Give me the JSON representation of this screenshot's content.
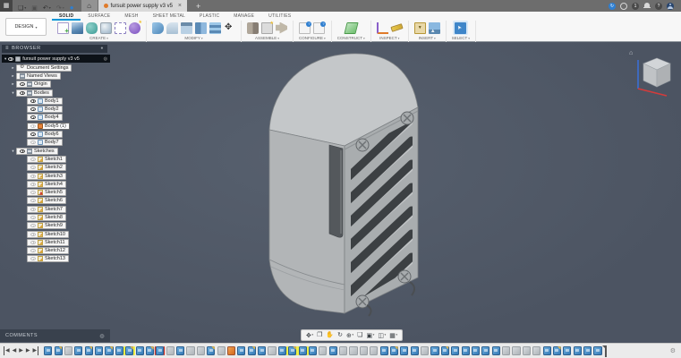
{
  "colors": {
    "accent_blue": "#0696d7",
    "viewport_bg": "#515a66",
    "model_gray": "#b3b6b8",
    "timeline_blue": "#3f8ac9",
    "highlight_yellow": "#eff046",
    "error_red": "#cf3b2f",
    "active_orange": "#e8833a"
  },
  "topbar": {
    "app_grid_glyph": "▦",
    "left_icons": [
      {
        "glyph": "❏",
        "cls": "caret",
        "name": "file-menu-icon"
      },
      {
        "glyph": "▣",
        "cls": "dim",
        "name": "save-icon"
      },
      {
        "glyph": "↶",
        "cls": "caret",
        "name": "undo-icon"
      },
      {
        "glyph": "↷",
        "cls": "dim caret",
        "name": "redo-icon"
      },
      {
        "glyph": "●",
        "cls": "blue",
        "name": "extension-icon"
      }
    ],
    "home_glyph": "⌂",
    "doc_tab": {
      "title": "fursuit power supply v3 v5",
      "close": "×"
    },
    "new_tab": "+",
    "right_icons": [
      {
        "glyph": "↻",
        "cls": "c-blue",
        "name": "job-status-icon"
      },
      {
        "glyph": "",
        "cls": "c-ring",
        "name": "status-ring-icon"
      },
      {
        "glyph": "1",
        "cls": "c-dark",
        "name": "notifications-count-icon"
      },
      {
        "glyph": "",
        "cls": "c-bell",
        "name": "bell-icon"
      },
      {
        "glyph": "?",
        "cls": "c-dark",
        "name": "help-icon"
      },
      {
        "glyph": "",
        "cls": "c-avatar",
        "name": "user-avatar"
      }
    ]
  },
  "toolbar": {
    "design_label": "DESIGN",
    "tabs": [
      {
        "label": "SOLID",
        "cls": "active"
      },
      {
        "label": "SURFACE",
        "cls": ""
      },
      {
        "label": "MESH",
        "cls": ""
      },
      {
        "label": "SHEET METAL",
        "cls": ""
      },
      {
        "label": "PLASTIC",
        "cls": ""
      },
      {
        "label": "MANAGE",
        "cls": ""
      },
      {
        "label": "UTILITIES",
        "cls": ""
      }
    ],
    "groups": [
      {
        "label": "CREATE",
        "icons": [
          "k-sketch",
          "k-box",
          "k-form",
          "k-sphere",
          "k-pattern",
          "k-sphere2"
        ]
      },
      {
        "label": "MODIFY",
        "icons": [
          "k-presspull",
          "k-fillet",
          "k-shell",
          "k-combine",
          "k-split",
          "k-move"
        ]
      },
      {
        "label": "ASSEMBLE",
        "icons": [
          "k-joint",
          "k-newcomp",
          "k-joint2"
        ]
      },
      {
        "label": "CONFIGURE",
        "icons": [
          "k-config",
          "k-config"
        ]
      },
      {
        "label": "CONSTRUCT",
        "icons": [
          "k-plane"
        ]
      },
      {
        "label": "INSPECT",
        "icons": [
          "k-measure",
          "k-ruler"
        ]
      },
      {
        "label": "INSERT",
        "icons": [
          "k-insert",
          "k-image"
        ]
      },
      {
        "label": "SELECT",
        "icons": [
          "k-select"
        ]
      }
    ]
  },
  "browser": {
    "title": "BROWSER",
    "menu_glyph": "≡",
    "filter_glyph": "●",
    "root_label": "fursuit power supply v3 v5",
    "root_radio": "◎",
    "items": [
      {
        "label": "Document Settings",
        "cls": "ind1 arr ic-gear"
      },
      {
        "label": "Named Views",
        "cls": "ind1 arr ic-grid"
      },
      {
        "label": "Origin",
        "cls": "ind1 arr eye ic-grid"
      },
      {
        "label": "Bodies",
        "cls": "ind1 arrd eye ic-grid"
      },
      {
        "label": "Body1",
        "cls": "ind2 eye ic-body"
      },
      {
        "label": "Body2",
        "cls": "ind2 eye ic-body"
      },
      {
        "label": "Body4",
        "cls": "ind2 eye ic-body"
      },
      {
        "label": "Body5 (1)",
        "cls": "ind2 eyedim ic-body-active sel"
      },
      {
        "label": "Body6",
        "cls": "ind2 eye ic-body"
      },
      {
        "label": "Body7",
        "cls": "ind2 eyedim ic-body"
      },
      {
        "label": "Sketches",
        "cls": "ind1 arrd eye ic-grid"
      },
      {
        "label": "Sketch1",
        "cls": "ind2 eyedim ic-sketch"
      },
      {
        "label": "Sketch2",
        "cls": "ind2 eyedim ic-sketch"
      },
      {
        "label": "Sketch3",
        "cls": "ind2 eyedim ic-sketch"
      },
      {
        "label": "Sketch4",
        "cls": "ind2 eyedim ic-sketch"
      },
      {
        "label": "Sketch5",
        "cls": "ind2 eyedim ic-sketch-err"
      },
      {
        "label": "Sketch6",
        "cls": "ind2 eyedim ic-sketch"
      },
      {
        "label": "Sketch7",
        "cls": "ind2 eyedim ic-sketch"
      },
      {
        "label": "Sketch8",
        "cls": "ind2 eyedim ic-sketch"
      },
      {
        "label": "Sketch9",
        "cls": "ind2 eyedim ic-sketch"
      },
      {
        "label": "Sketch10",
        "cls": "ind2 eyedim ic-sketch"
      },
      {
        "label": "Sketch11",
        "cls": "ind2 eyedim ic-sketch"
      },
      {
        "label": "Sketch12",
        "cls": "ind2 eyedim ic-sketch"
      },
      {
        "label": "Sketch13",
        "cls": "ind2 eyedim ic-sketch"
      }
    ]
  },
  "navbar": {
    "icons": [
      {
        "glyph": "✥",
        "cls": "caret",
        "name": "pan-orbit-icon"
      },
      {
        "glyph": "❐",
        "cls": "",
        "name": "look-at-icon"
      },
      {
        "glyph": "✋",
        "cls": "",
        "name": "pan-hand-icon"
      },
      {
        "glyph": "↻",
        "cls": "",
        "name": "orbit-icon"
      },
      {
        "glyph": "⊕",
        "cls": "caret",
        "name": "zoom-icon"
      },
      {
        "glyph": "❏",
        "cls": "",
        "name": "fit-icon"
      },
      {
        "glyph": "▣",
        "cls": "caret",
        "name": "display-settings-icon"
      },
      {
        "glyph": "◫",
        "cls": "caret",
        "name": "viewports-icon"
      },
      {
        "glyph": "▦",
        "cls": "caret",
        "name": "grid-snap-icon"
      }
    ]
  },
  "comments": {
    "title": "COMMENTS",
    "dot_glyph": "◍"
  },
  "timeline": {
    "controls": [
      {
        "glyph": "◀",
        "cls": "bar-l",
        "name": "skip-to-start-button"
      },
      {
        "glyph": "◀",
        "cls": "",
        "name": "step-back-button"
      },
      {
        "glyph": "▶",
        "cls": "",
        "name": "play-button"
      },
      {
        "glyph": "▶",
        "cls": "",
        "name": "step-forward-button"
      },
      {
        "glyph": "▶",
        "cls": "bar-r",
        "name": "skip-to-end-button"
      }
    ],
    "icons": [
      "f",
      "s",
      "g",
      "f",
      "s",
      "f",
      "s",
      "f",
      "s y",
      "f",
      "s",
      "f r",
      "g",
      "f",
      "g",
      "g",
      "s",
      "g",
      "o",
      "f",
      "s",
      "f",
      "g",
      "f",
      "s y",
      "f y",
      "f",
      "g",
      "f",
      "g",
      "g",
      "g",
      "g",
      "f",
      "s",
      "f",
      "f",
      "g",
      "f",
      "s",
      "f",
      "f",
      "f",
      "f",
      "f",
      "g",
      "g",
      "g",
      "g",
      "f",
      "s",
      "f",
      "f",
      "f",
      "f"
    ],
    "gear_glyph": "⚙"
  }
}
